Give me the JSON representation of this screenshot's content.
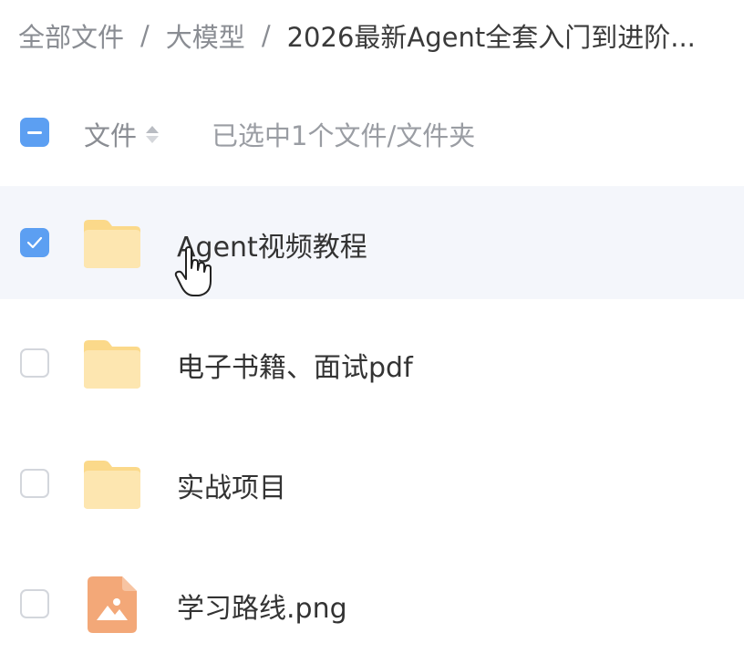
{
  "breadcrumb": {
    "items": [
      "全部文件",
      "大模型",
      "2026最新Agent全套入门到进阶..."
    ],
    "separator": "/"
  },
  "list_header": {
    "column_label": "文件",
    "selection_info": "已选中1个文件/文件夹",
    "select_all_state": "indeterminate"
  },
  "files": [
    {
      "name": "Agent视频教程",
      "type": "folder",
      "checked": true
    },
    {
      "name": "电子书籍、面试pdf",
      "type": "folder",
      "checked": false
    },
    {
      "name": "实战项目",
      "type": "folder",
      "checked": false
    },
    {
      "name": "学习路线.png",
      "type": "image",
      "checked": false
    }
  ],
  "colors": {
    "accent": "#5c9ff2",
    "folder": "#fbd98a",
    "image_icon": "#f3a878",
    "selected_row": "#f4f6fb"
  }
}
